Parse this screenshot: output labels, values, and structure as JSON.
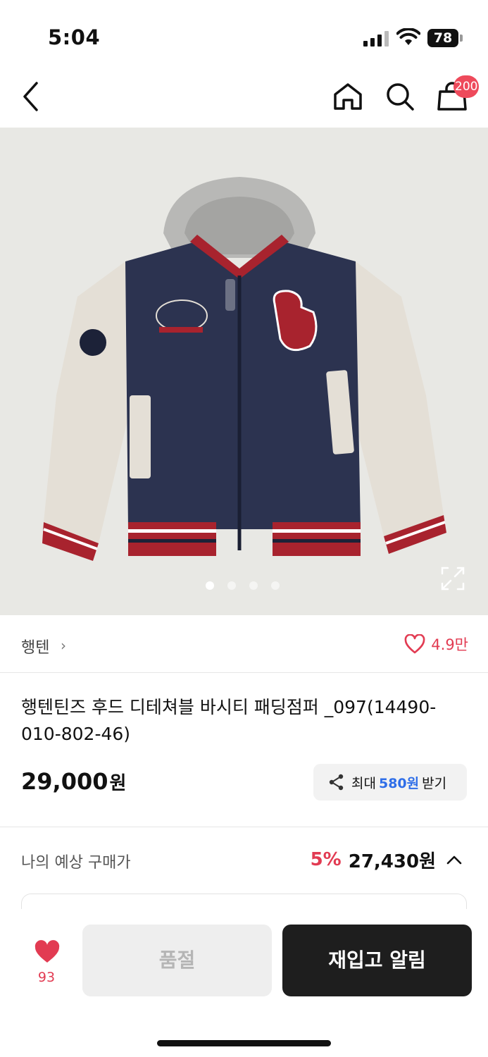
{
  "status_bar": {
    "time": "5:04",
    "battery": "78"
  },
  "nav": {
    "cart_badge": "200",
    "icons": [
      "back-icon",
      "home-icon",
      "search-icon",
      "shopping-bag-icon"
    ]
  },
  "gallery": {
    "slide_count": 4,
    "active_slide": 1,
    "image_alt": "navy and cream varsity jacket with grey hood",
    "expand_icon": "fullscreen-icon"
  },
  "brand": {
    "name": "행텐",
    "chevron": "›",
    "likes": "4.9만"
  },
  "product": {
    "title": "행텐틴즈 후드 디테쳐블 바시티 패딩점퍼 _097(14490-010-802-46)",
    "price": "29,000",
    "price_unit": "원"
  },
  "reward": {
    "prefix": "최대",
    "amount": "580원",
    "suffix": "받기"
  },
  "expected": {
    "label": "나의 예상 구매가",
    "discount": "5%",
    "price": "27,430원"
  },
  "bottom_bar": {
    "wish_count": "93",
    "soldout_label": "품절",
    "restock_label": "재입고 알림"
  },
  "colors": {
    "accent_red": "#e23b52",
    "badge_red": "#ee4a5b",
    "link_blue": "#2f6ee8",
    "dark_button": "#1e1e1e"
  }
}
